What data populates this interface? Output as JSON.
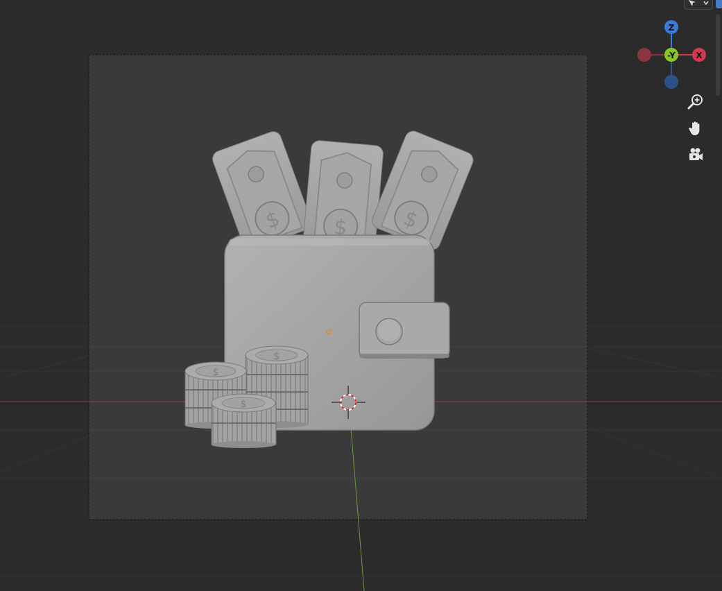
{
  "viewport": {
    "background": "#2b2b2b",
    "camera_frame_fill": "#3a3a3a",
    "model_color": "#a8a8a8",
    "x_axis_color": "#9a3a48",
    "y_axis_color": "#6a9a3a",
    "origin_color": "#e08a2a"
  },
  "gizmo": {
    "z_label": "Z",
    "y_label": "-Y",
    "x_label": "X",
    "z_color": "#3a7ad8",
    "y_color": "#8ac82a",
    "x_color": "#d0394e",
    "neg_x_color": "#8a3444",
    "neg_z_color": "#2d5287"
  },
  "nav_tools": [
    {
      "icon": "zoom-icon"
    },
    {
      "icon": "hand-pan-icon"
    },
    {
      "icon": "camera-view-icon"
    }
  ],
  "model": {
    "bill_symbol": "$",
    "coin_symbol": "$"
  }
}
